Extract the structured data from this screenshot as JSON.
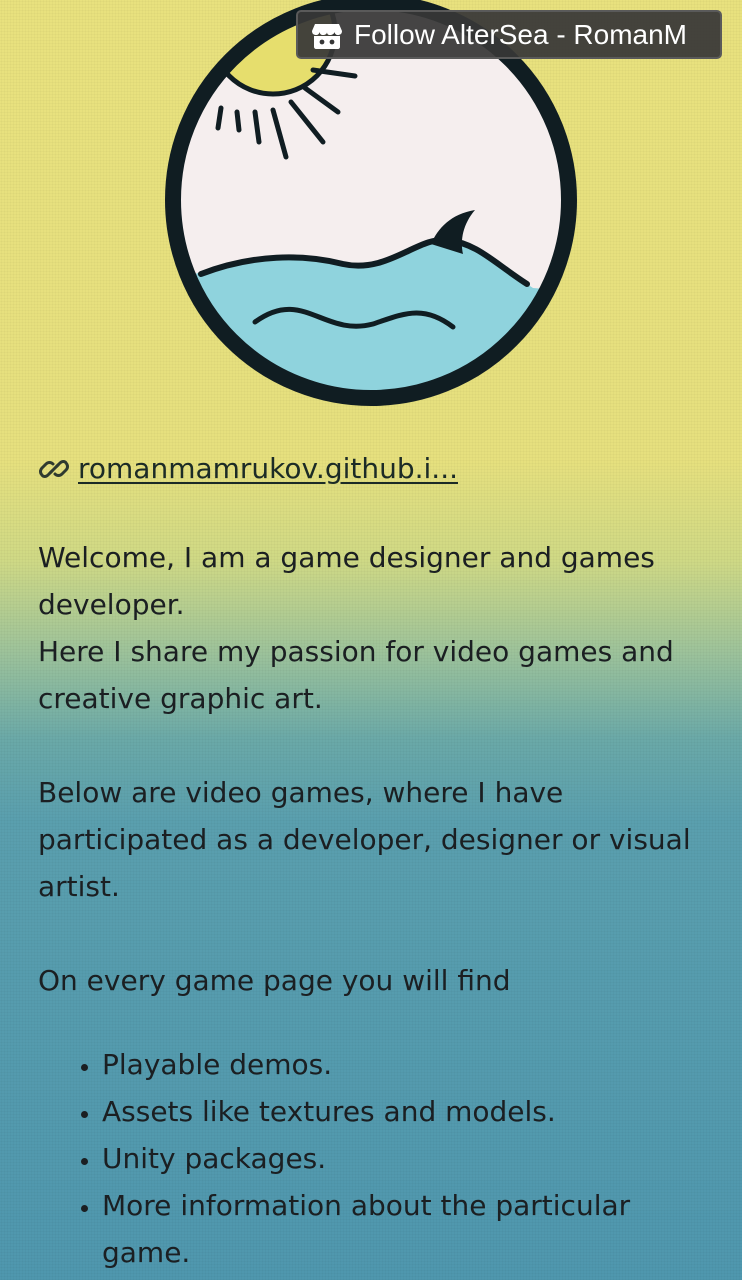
{
  "follow_button": {
    "label": "Follow AlterSea - RomanM"
  },
  "profile": {
    "link_text": "romanmamrukov.github.i...",
    "intro_line1": "Welcome, I am a game designer and games developer.",
    "intro_line2": "Here I share my passion for video games and creative graphic art.",
    "paragraph2": "Below are video games, where I have participated as a developer, designer or visual artist.",
    "paragraph3": "On every game page you will find",
    "list_items": [
      "Playable demos.",
      "Assets like textures and models.",
      "Unity packages.",
      "More information about the particular game."
    ]
  }
}
